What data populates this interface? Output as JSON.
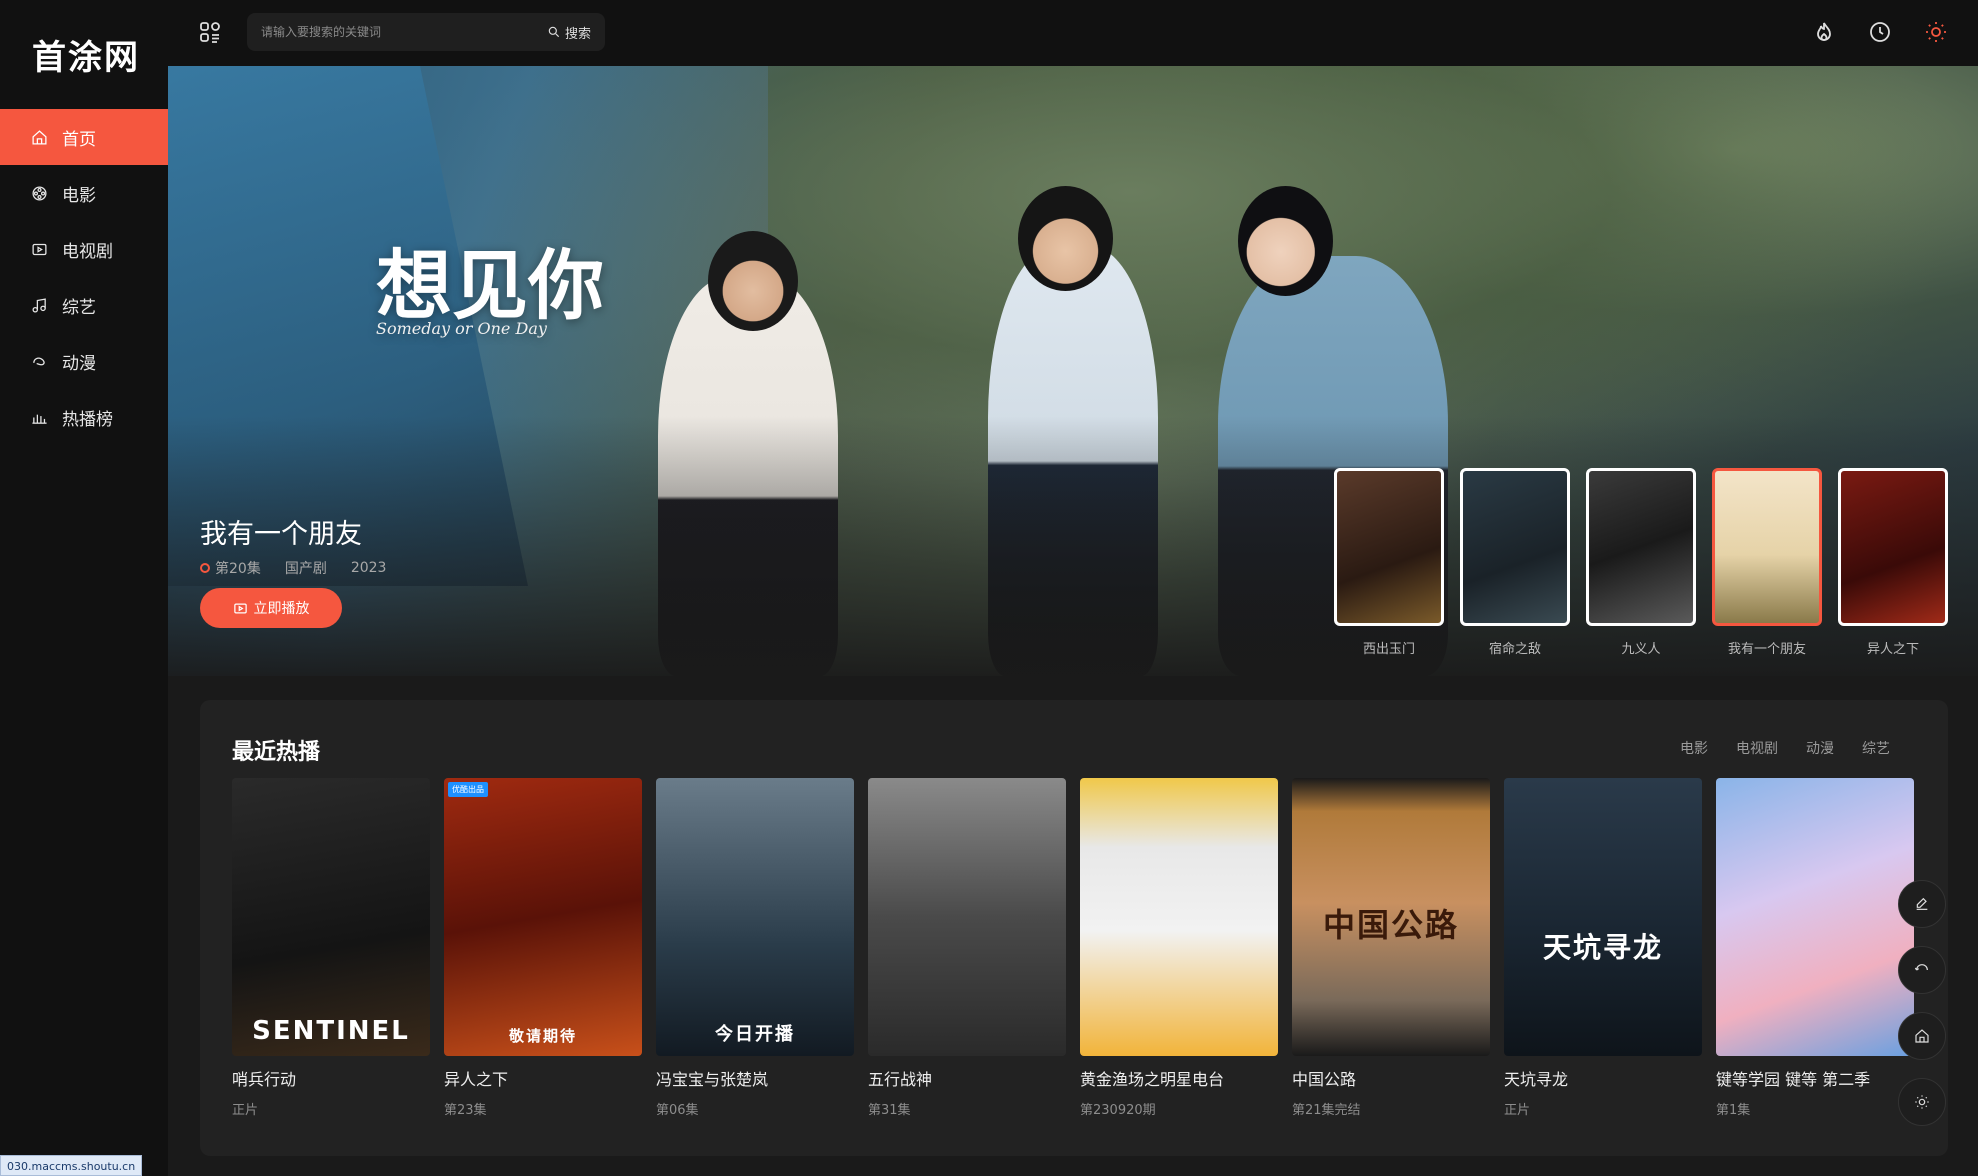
{
  "site": {
    "logo": "首涂网"
  },
  "sidebar": {
    "items": [
      {
        "label": "首页",
        "icon": "home-icon",
        "active": true
      },
      {
        "label": "电影",
        "icon": "film-reel-icon"
      },
      {
        "label": "电视剧",
        "icon": "tv-icon"
      },
      {
        "label": "综艺",
        "icon": "music-note-icon"
      },
      {
        "label": "动漫",
        "icon": "anime-icon"
      },
      {
        "label": "热播榜",
        "icon": "bar-chart-icon"
      }
    ]
  },
  "search": {
    "placeholder": "请输入要搜索的关键词",
    "button_label": "搜索"
  },
  "topbar": {
    "icons": [
      "flame-icon",
      "clock-icon",
      "sun-icon"
    ]
  },
  "hero": {
    "logo_text": "想见你",
    "logo_sub": "Someday or One Day",
    "title": "我有一个朋友",
    "episode": "第20集",
    "genre": "国产剧",
    "year": "2023",
    "play_label": "立即播放",
    "thumbnails": [
      {
        "caption": "西出玉门"
      },
      {
        "caption": "宿命之敌"
      },
      {
        "caption": "九义人"
      },
      {
        "caption": "我有一个朋友",
        "active": true
      },
      {
        "caption": "异人之下"
      }
    ]
  },
  "recent": {
    "title": "最近热播",
    "tabs": [
      "电影",
      "电视剧",
      "动漫",
      "综艺"
    ],
    "items": [
      {
        "name": "哨兵行动",
        "episode": "正片",
        "poster_text": "SENTINEL"
      },
      {
        "name": "异人之下",
        "episode": "第23集",
        "poster_text": "敬请期待",
        "badge": "优酷出品"
      },
      {
        "name": "冯宝宝与张楚岚",
        "episode": "第06集",
        "poster_text": "今日开播"
      },
      {
        "name": "五行战神",
        "episode": "第31集",
        "poster_text": ""
      },
      {
        "name": "黄金渔场之明星电台",
        "episode": "第230920期",
        "poster_text": ""
      },
      {
        "name": "中国公路",
        "episode": "第21集完结",
        "poster_text": "中国公路"
      },
      {
        "name": "天坑寻龙",
        "episode": "正片",
        "poster_text": "天坑寻龙"
      },
      {
        "name": "键等学园 键等 第二季",
        "episode": "第1集",
        "poster_text": ""
      }
    ]
  },
  "float_tools": [
    "edit-icon",
    "refresh-icon",
    "home-icon",
    "sun-icon"
  ],
  "status_url": "030.maccms.shoutu.cn",
  "colors": {
    "accent": "#f5573f",
    "background": "#1a1a1a",
    "sidebar": "#111111",
    "panel": "#222222"
  }
}
